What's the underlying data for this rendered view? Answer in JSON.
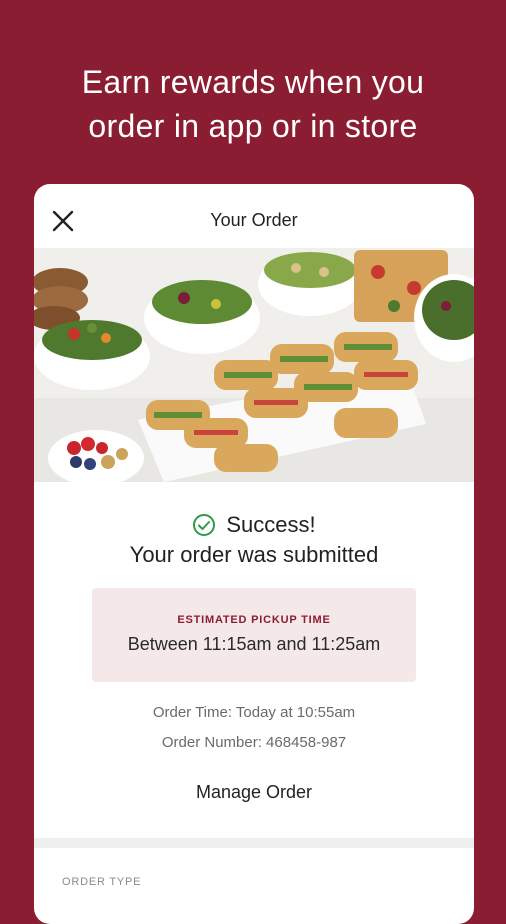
{
  "promo": {
    "headline_line1": "Earn rewards when you",
    "headline_line2": "order in app or in store"
  },
  "header": {
    "title": "Your Order",
    "close_icon": "close-icon"
  },
  "status": {
    "success_label": "Success!",
    "message": "Your order was submitted",
    "icon": "check-circle-icon",
    "icon_color": "#2e9a4a"
  },
  "pickup": {
    "label": "ESTIMATED PICKUP TIME",
    "value": "Between 11:15am and 11:25am"
  },
  "details": {
    "order_time": "Order Time: Today at 10:55am",
    "order_number": "Order Number: 468458-987"
  },
  "actions": {
    "manage_order": "Manage Order"
  },
  "section": {
    "order_type_label": "ORDER TYPE"
  },
  "colors": {
    "brand": "#8b1d32",
    "pickup_bg": "#f5e8e9"
  }
}
